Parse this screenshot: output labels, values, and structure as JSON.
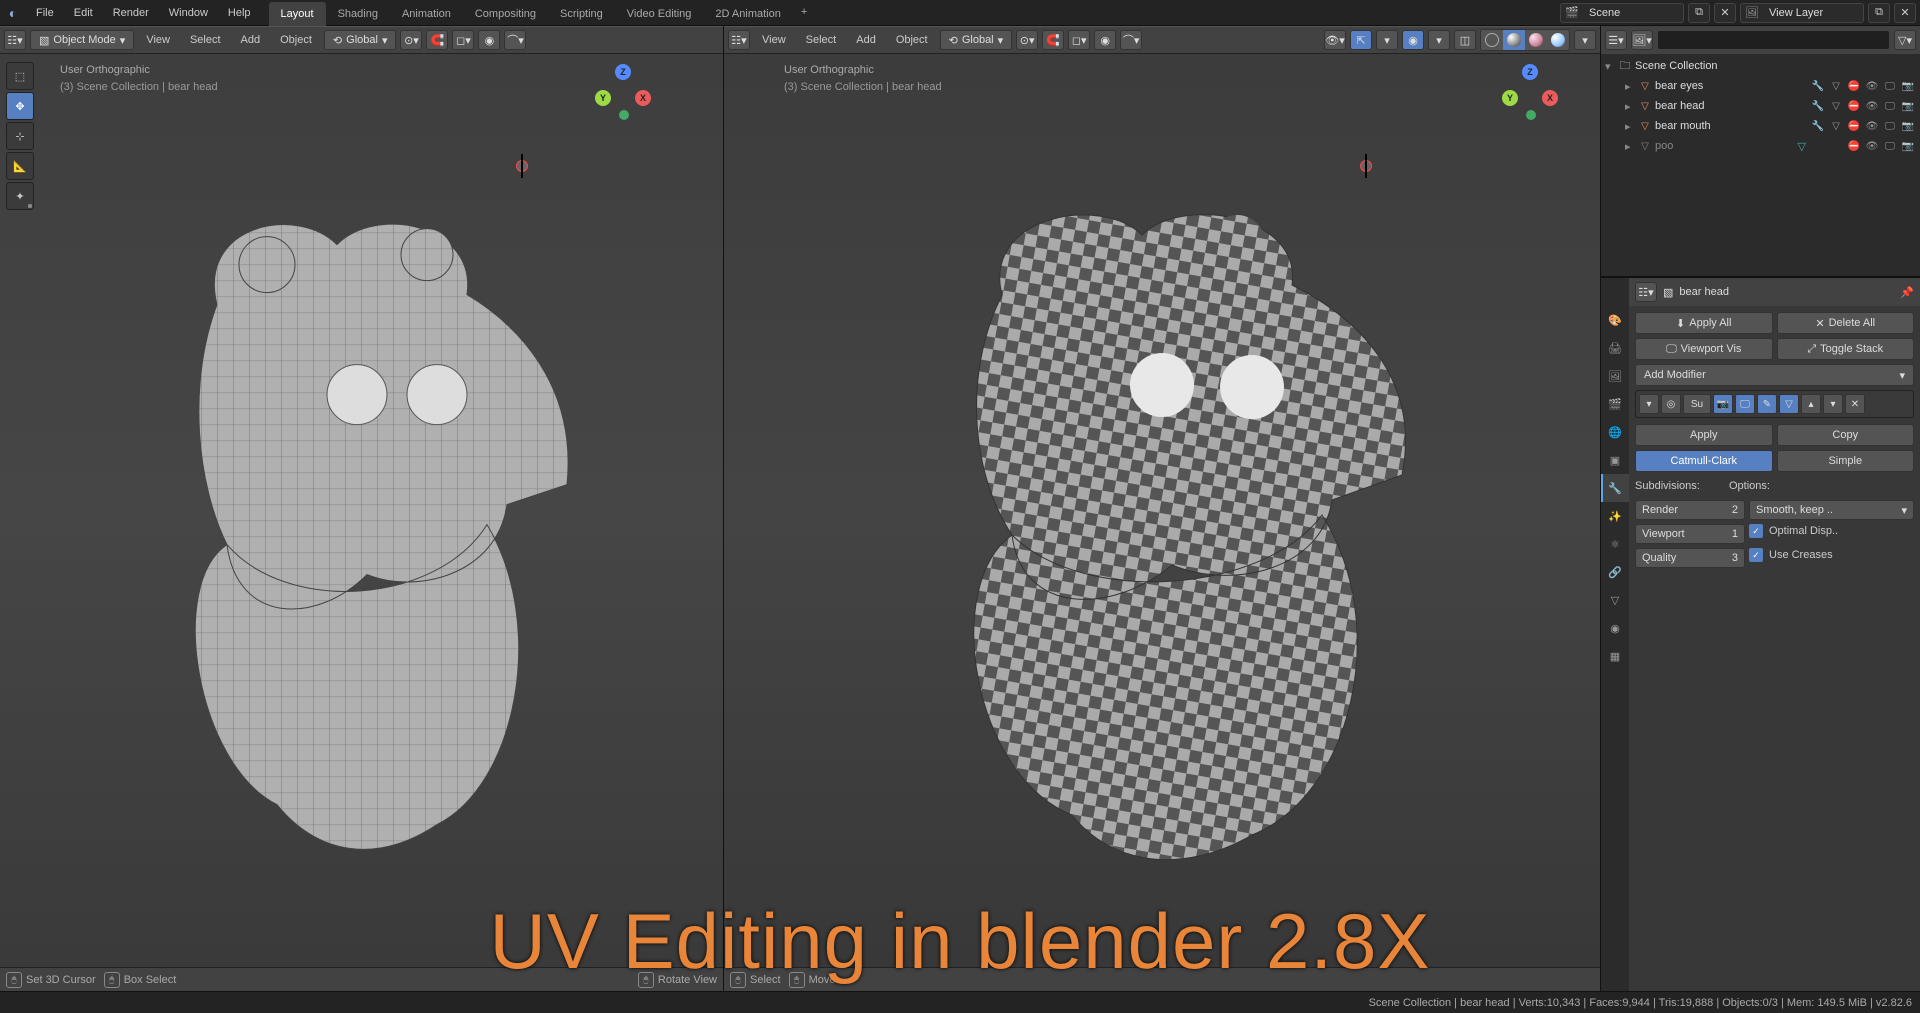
{
  "topmenu": {
    "file": "File",
    "edit": "Edit",
    "render": "Render",
    "window": "Window",
    "help": "Help"
  },
  "workspaces": {
    "layout": "Layout",
    "shading": "Shading",
    "animation": "Animation",
    "compositing": "Compositing",
    "scripting": "Scripting",
    "video": "Video Editing",
    "anim2d": "2D Animation",
    "add": "+"
  },
  "scene": {
    "name": "Scene",
    "layer": "View Layer"
  },
  "vpheader": {
    "mode": "Object Mode",
    "view": "View",
    "select": "Select",
    "add": "Add",
    "object": "Object",
    "orientation": "Global"
  },
  "viewport": {
    "projection": "User Orthographic",
    "path": "(3) Scene Collection | bear head"
  },
  "gizmo": {
    "x": "X",
    "y": "Y",
    "z": "Z"
  },
  "footer_left": {
    "cursor": "Set 3D Cursor",
    "box": "Box Select",
    "rotate": "Rotate View"
  },
  "footer_right": {
    "select": "Select",
    "move": "Move"
  },
  "outliner": {
    "root": "Scene Collection",
    "items": [
      {
        "name": "bear eyes"
      },
      {
        "name": "bear head"
      },
      {
        "name": "bear mouth"
      },
      {
        "name": "poo"
      }
    ]
  },
  "props": {
    "object": "bear head",
    "apply_all": "Apply All",
    "delete_all": "Delete All",
    "viewport_vis": "Viewport Vis",
    "toggle_stack": "Toggle Stack",
    "add_modifier": "Add Modifier",
    "mod_name": "Su",
    "apply": "Apply",
    "copy": "Copy",
    "catmull": "Catmull-Clark",
    "simple": "Simple",
    "subdivisions": "Subdivisions:",
    "options": "Options:",
    "render": "Render",
    "render_val": "2",
    "viewport": "Viewport",
    "viewport_val": "1",
    "quality": "Quality",
    "quality_val": "3",
    "smooth": "Smooth, keep ..",
    "optimal": "Optimal Disp..",
    "creases": "Use Creases"
  },
  "statusbar": "Scene Collection | bear head | Verts:10,343 | Faces:9,944 | Tris:19,888 | Objects:0/3 | Mem: 149.5 MiB | v2.82.6",
  "title": "UV Editing in blender 2.8X"
}
